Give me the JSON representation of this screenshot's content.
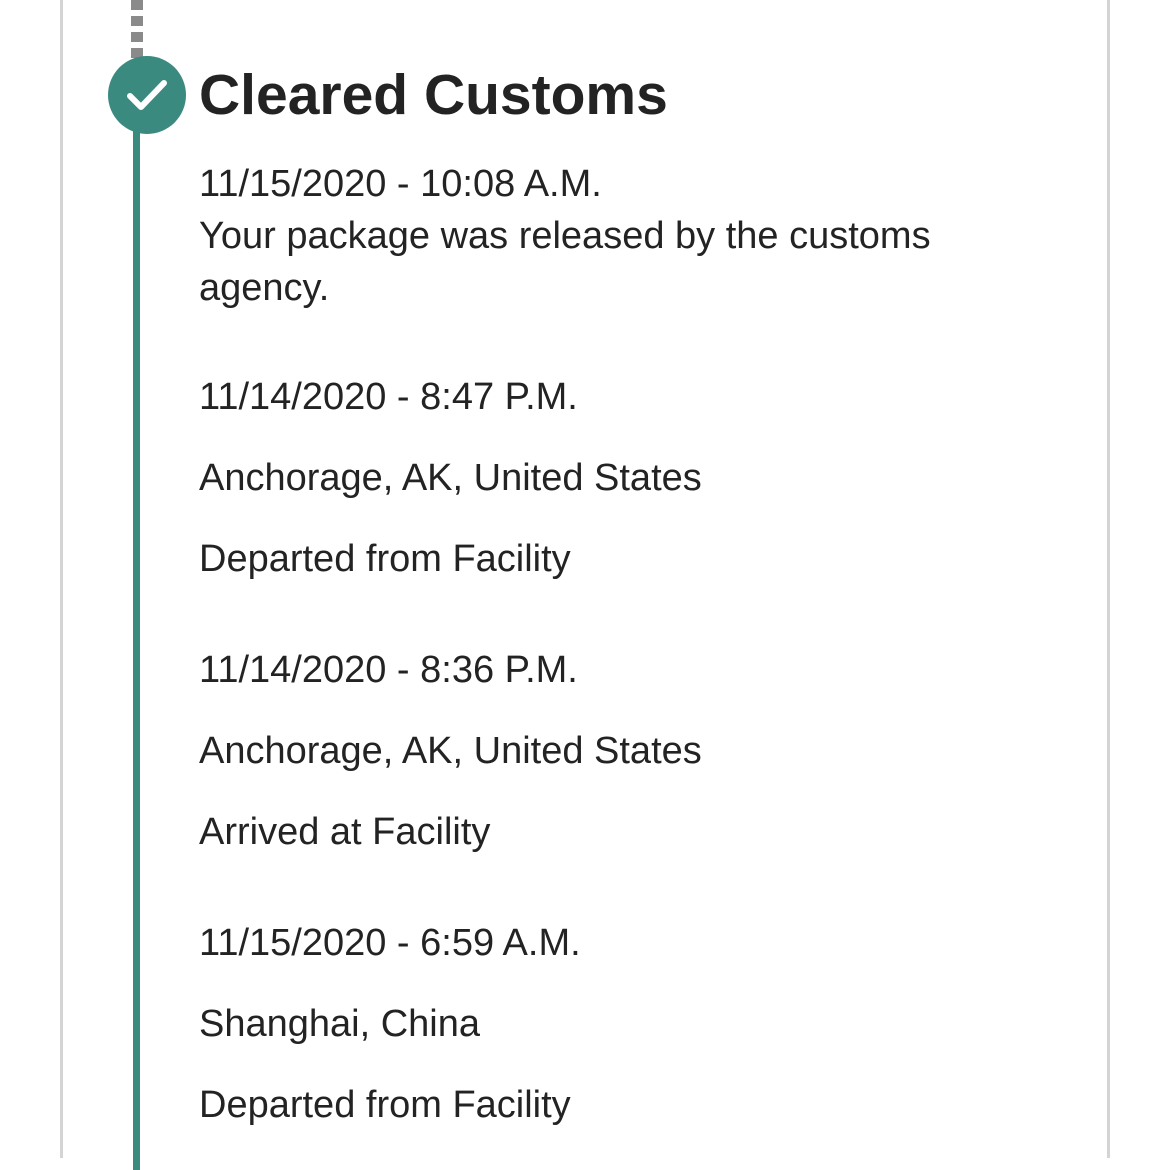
{
  "status": {
    "title": "Cleared Customs",
    "icon": "check-icon",
    "accent_color": "#3b8a80"
  },
  "events": [
    {
      "datetime": "11/15/2020 - 10:08 A.M.",
      "description": "Your package was released by the customs agency."
    },
    {
      "datetime": "11/14/2020 - 8:47 P.M.",
      "location": "Anchorage, AK, United States",
      "description": "Departed from Facility"
    },
    {
      "datetime": "11/14/2020 - 8:36 P.M.",
      "location": "Anchorage, AK, United States",
      "description": "Arrived at Facility"
    },
    {
      "datetime": "11/15/2020 - 6:59 A.M.",
      "location": "Shanghai, China",
      "description": "Departed from Facility"
    }
  ]
}
